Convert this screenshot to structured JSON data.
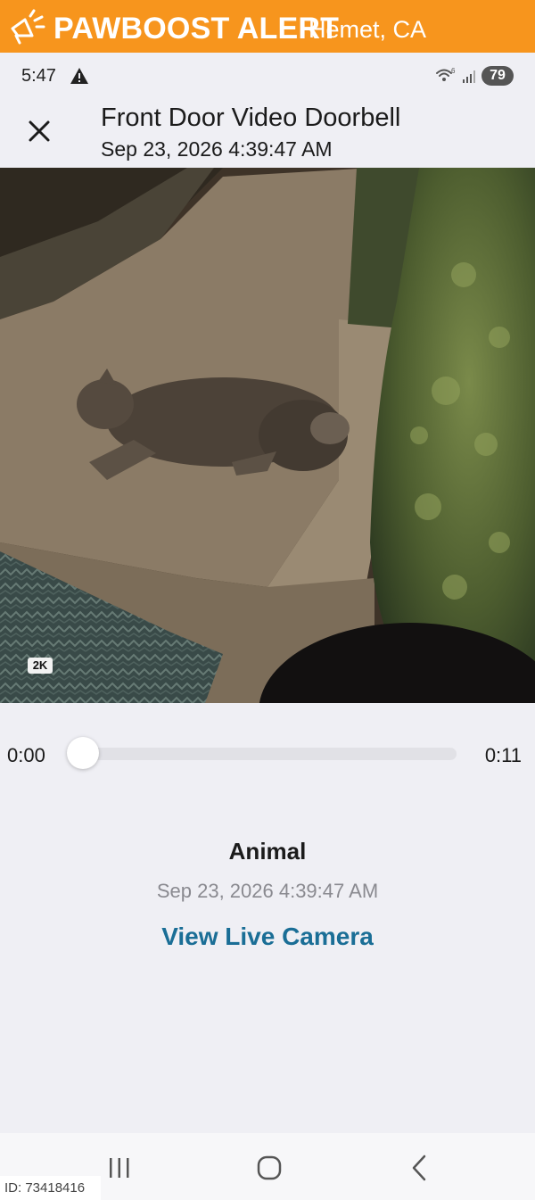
{
  "banner": {
    "brand": "PAWBOOST ALERT",
    "location": "Hemet, CA",
    "logo_icon": "pawboost-megaphone-icon",
    "color": "#f7951d"
  },
  "status_bar": {
    "time": "5:47",
    "warning_icon": "warning-icon",
    "wifi_icon": "wifi-icon",
    "signal_icon": "signal-icon",
    "battery": "79"
  },
  "header": {
    "title": "Front Door Video Doorbell",
    "subtitle": "Sep 23, 2026 4:39:47 AM",
    "close_icon": "close-icon"
  },
  "video": {
    "quality_badge": "2K"
  },
  "player": {
    "current_time": "0:00",
    "duration": "0:11",
    "progress": 0.0
  },
  "event": {
    "label": "Animal",
    "timestamp": "Sep 23, 2026 4:39:47 AM",
    "action": "View Live Camera",
    "action_color": "#1a6e96"
  },
  "navigation": {
    "recents_icon": "recents-icon",
    "home_icon": "home-icon",
    "back_icon": "back-icon"
  },
  "footer": {
    "id_text": "ID: 73418416"
  }
}
